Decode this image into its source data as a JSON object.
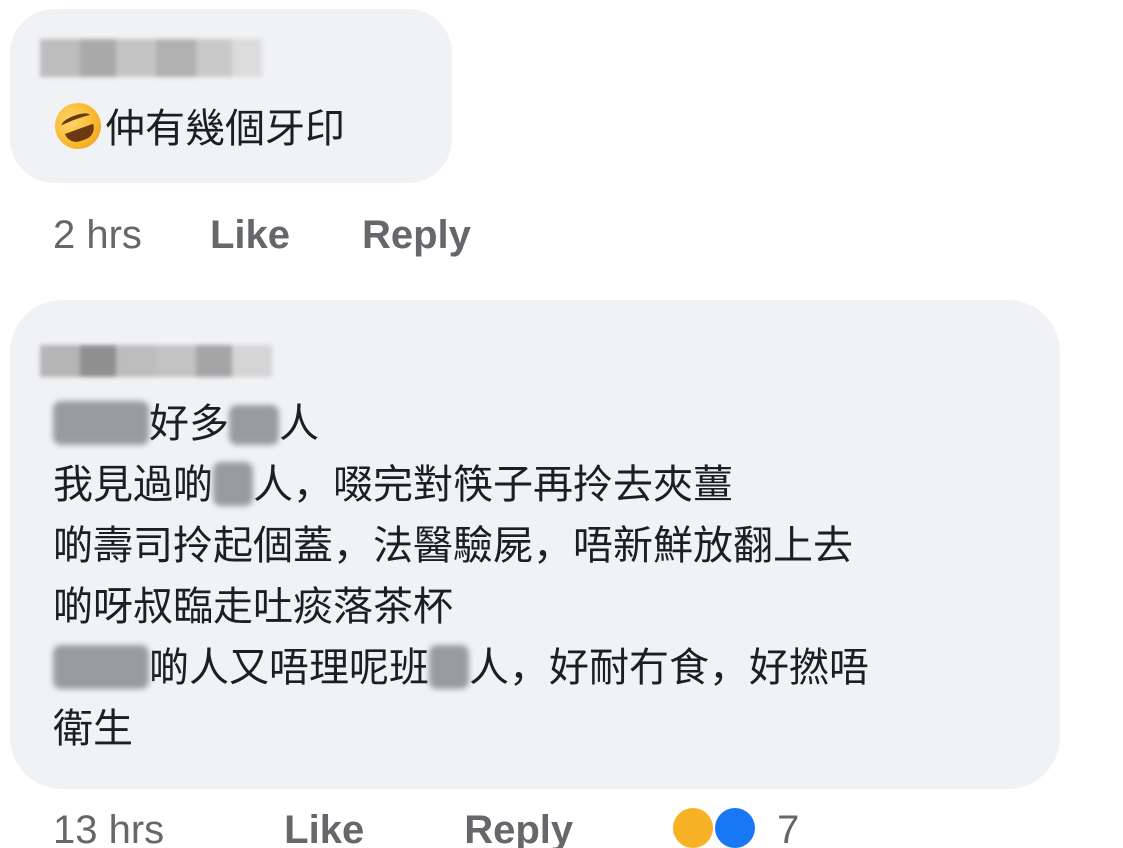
{
  "comments": [
    {
      "author_redacted": true,
      "text_emoji": "rolling-on-floor-laughing",
      "text": "仲有幾個牙印",
      "time": "2 hrs",
      "like_label": "Like",
      "reply_label": "Reply"
    },
    {
      "author_redacted": true,
      "lines": [
        {
          "before": "",
          "after": "好多",
          "tail": "人"
        },
        {
          "before": "我見過啲",
          "after": "人，啜完對筷子再拎去夾薑"
        },
        {
          "text": "啲壽司拎起個蓋，法醫驗屍，唔新鮮放翻上去"
        },
        {
          "text": "啲呀叔臨走吐痰落茶杯"
        },
        {
          "before": "",
          "mid": "啲人又唔理呢班",
          "after": "人，好耐冇食，好撚唔"
        },
        {
          "text": "衛生"
        }
      ],
      "time": "13 hrs",
      "like_label": "Like",
      "reply_label": "Reply",
      "reaction_icons": [
        "haha-icon",
        "like-icon"
      ],
      "reaction_count": "7"
    }
  ],
  "colors": {
    "bubble": "#f0f2f5",
    "text": "#1c1e21",
    "meta": "#65676b"
  }
}
